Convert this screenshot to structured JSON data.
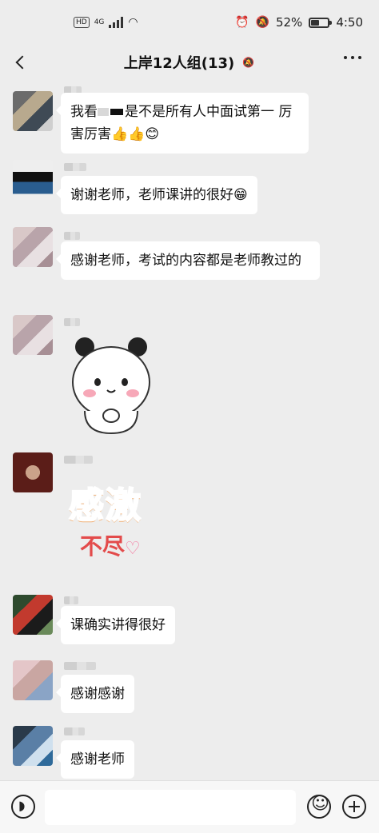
{
  "status": {
    "network_badge": "HD",
    "network_type": "4G",
    "battery_percent": "52%",
    "battery_level": 0.52,
    "time": "4:50"
  },
  "nav": {
    "title": "上岸12人组(13)",
    "mute_icon": "bell-mute-icon"
  },
  "messages": [
    {
      "bubble_text_a": "我看",
      "bubble_text_b": "是不是所有人中面试第一 厉害厉害👍👍😊"
    },
    {
      "bubble_text": "谢谢老师，老师课讲的很好😁"
    },
    {
      "bubble_text": "感谢老师，考试的内容都是老师教过的"
    },
    {
      "sticker": "panda-thanks-sticker"
    },
    {
      "sticker_main": "感激",
      "sticker_sub": "不尽"
    },
    {
      "bubble_text": "课确实讲得很好"
    },
    {
      "bubble_text": "感谢感谢"
    },
    {
      "bubble_text": "感谢老师"
    }
  ],
  "inputbar": {
    "voice_icon": "voice-icon",
    "emoji_icon": "emoji-icon",
    "plus_icon": "plus-icon"
  }
}
